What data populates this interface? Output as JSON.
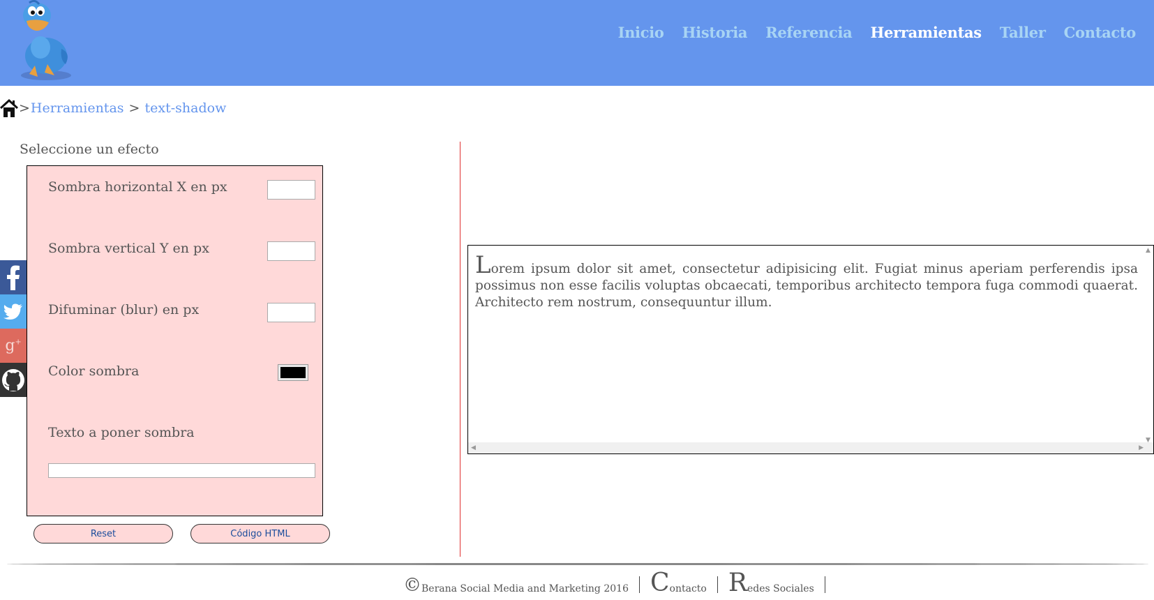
{
  "nav": {
    "items": [
      {
        "label": "Inicio",
        "active": false
      },
      {
        "label": "Historia",
        "active": false
      },
      {
        "label": "Referencia",
        "active": false
      },
      {
        "label": "Herramientas",
        "active": true
      },
      {
        "label": "Taller",
        "active": false
      },
      {
        "label": "Contacto",
        "active": false
      }
    ]
  },
  "breadcrumb": {
    "sep1": ">",
    "section": "Herramientas",
    "sep2": " > ",
    "page": "text-shadow"
  },
  "form": {
    "title": "Seleccione un efecto",
    "fields": {
      "x_label": "Sombra horizontal X en px",
      "x_value": "",
      "y_label": "Sombra vertical Y en px",
      "y_value": "",
      "blur_label": "Difuminar (blur) en px",
      "blur_value": "",
      "color_label": "Color sombra",
      "color_value": "#000000",
      "text_label": "Texto a poner sombra",
      "text_value": ""
    },
    "reset_label": "Reset",
    "code_label": "Código HTML"
  },
  "social": [
    {
      "icon": "facebook-icon",
      "color": "#3b5998"
    },
    {
      "icon": "twitter-icon",
      "color": "#55acee"
    },
    {
      "icon": "google-plus-icon",
      "color": "#dd4b39"
    },
    {
      "icon": "github-icon",
      "color": "#333333"
    }
  ],
  "preview": {
    "first_letter": "L",
    "text": "orem ipsum dolor sit amet, consectetur adipisicing elit. Fugiat minus aperiam perferendis ipsa possimus non esse facilis voluptas obcaecati, temporibus architecto tempora fuga commodi quaerat. Architecto rem nostrum, consequuntur illum."
  },
  "footer": {
    "copyright_symbol": "©",
    "copyright_text": "Berana Social Media and Marketing 2016",
    "contact_initial": "C",
    "contact_rest": "ontacto",
    "social_initial": "R",
    "social_rest": "edes Sociales"
  },
  "colors": {
    "header": "#6495ed",
    "nav_link": "#a8d4f4",
    "nav_active": "#ffffff",
    "panel": "#ffd9d9",
    "divider": "#e03030"
  }
}
